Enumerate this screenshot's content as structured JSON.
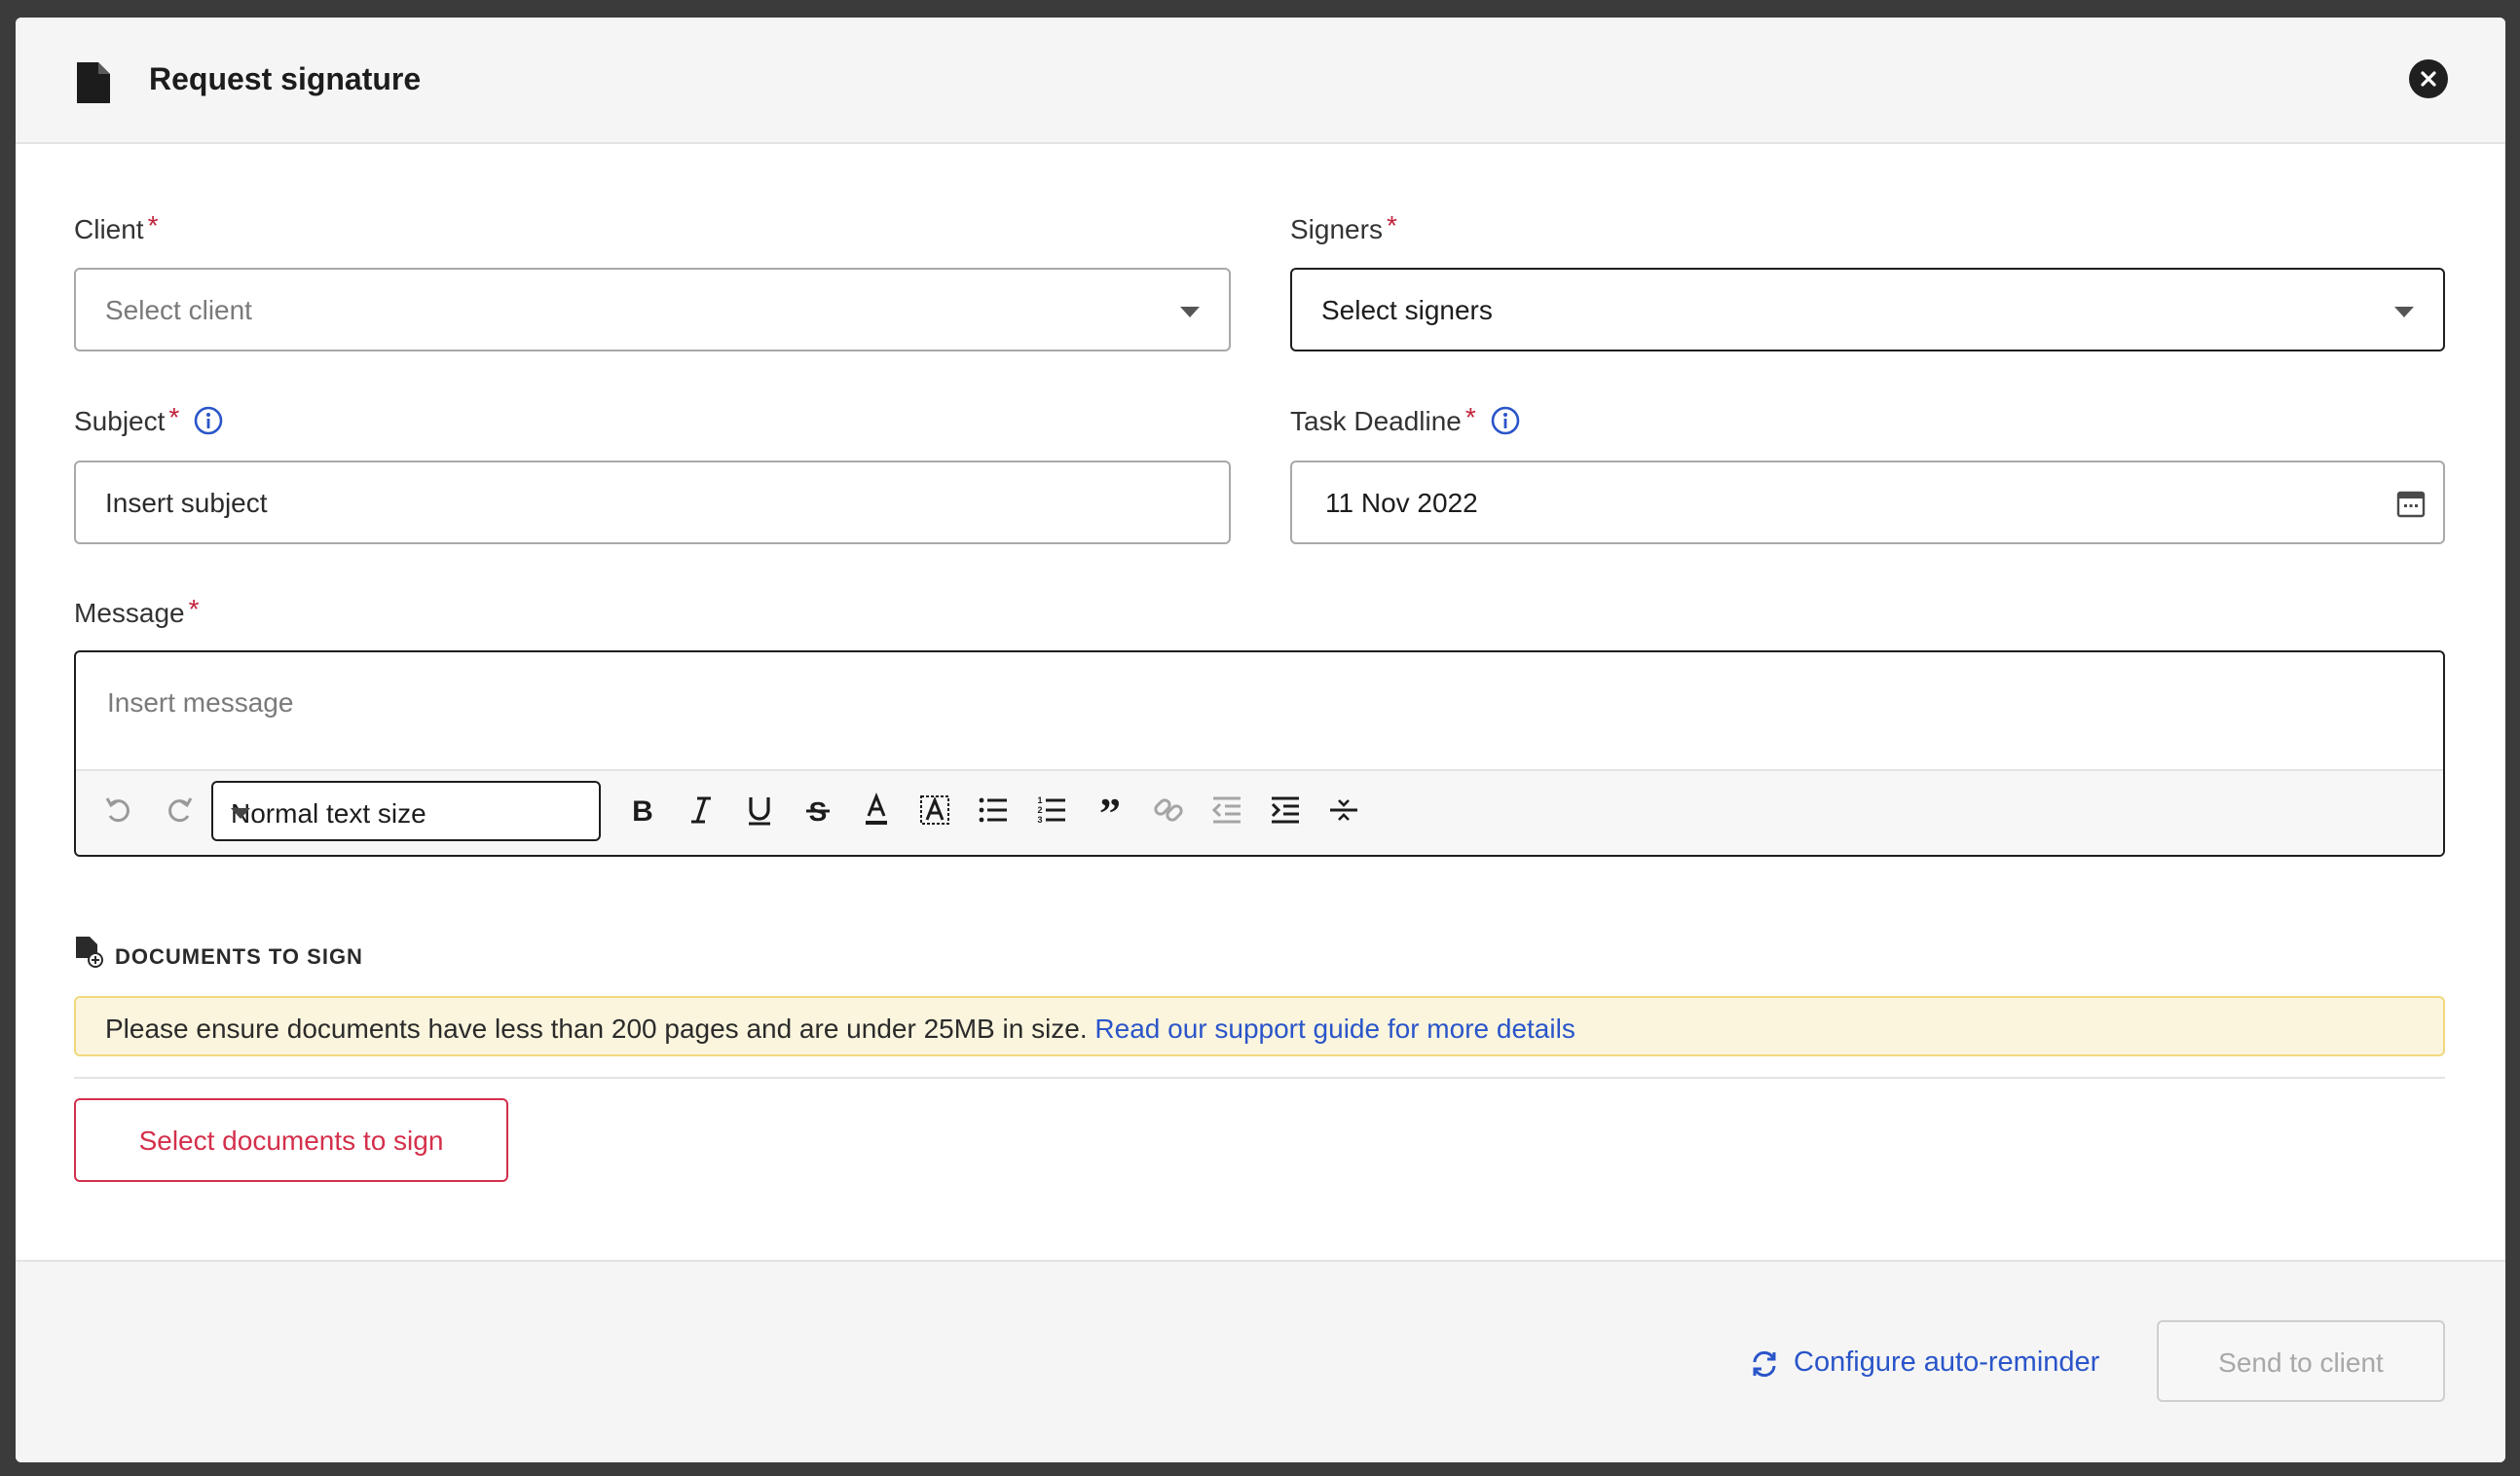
{
  "header": {
    "title": "Request signature"
  },
  "form": {
    "client": {
      "label": "Client",
      "required": "*",
      "placeholder": "Select client"
    },
    "signers": {
      "label": "Signers",
      "required": "*",
      "value": "Select signers"
    },
    "subject": {
      "label": "Subject",
      "required": "*",
      "placeholder": "Insert subject"
    },
    "deadline": {
      "label": "Task Deadline",
      "required": "*",
      "value": "11 Nov 2022"
    },
    "message": {
      "label": "Message",
      "required": "*",
      "placeholder": "Insert message"
    }
  },
  "toolbar": {
    "text_size": "Normal text size",
    "buttons": [
      "undo",
      "redo",
      "bold",
      "italic",
      "underline",
      "strikethrough",
      "font-color",
      "highlight",
      "bullet-list",
      "numbered-list",
      "blockquote",
      "link",
      "outdent",
      "indent",
      "horizontal-rule"
    ]
  },
  "documents": {
    "heading": "DOCUMENTS TO SIGN",
    "notice_text": "Please ensure documents have less than 200 pages and are under 25MB in size. ",
    "notice_link": "Read our support guide for more details",
    "select_label": "Select documents to sign"
  },
  "footer": {
    "reminder_label": "Configure auto-reminder",
    "send_label": "Send to client"
  },
  "colors": {
    "accent_blue": "#2a55c9",
    "danger_red": "#d4304b",
    "notice_bg": "#fbf5de"
  }
}
